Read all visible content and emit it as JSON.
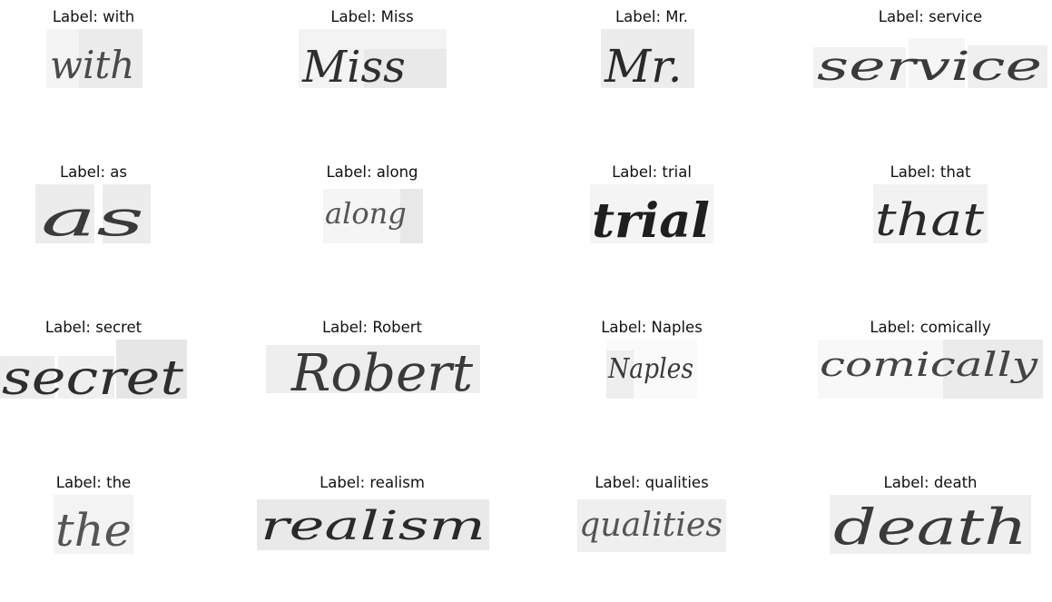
{
  "label_prefix": "Label:",
  "samples": [
    {
      "label": "with"
    },
    {
      "label": "Miss"
    },
    {
      "label": "Mr."
    },
    {
      "label": "service"
    },
    {
      "label": "as"
    },
    {
      "label": "along"
    },
    {
      "label": "trial"
    },
    {
      "label": "that"
    },
    {
      "label": "secret"
    },
    {
      "label": "Robert"
    },
    {
      "label": "Naples"
    },
    {
      "label": "comically"
    },
    {
      "label": "the"
    },
    {
      "label": "realism"
    },
    {
      "label": "qualities"
    },
    {
      "label": "death"
    }
  ]
}
